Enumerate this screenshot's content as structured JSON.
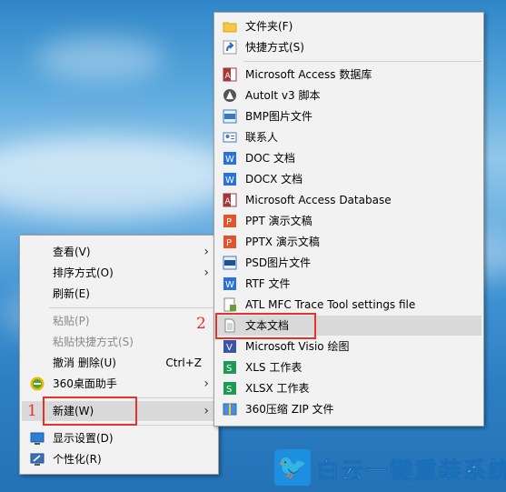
{
  "context_menu": {
    "items": [
      {
        "label": "查看(V)",
        "shortcut": "",
        "submenu": true,
        "disabled": false,
        "icon": ""
      },
      {
        "label": "排序方式(O)",
        "shortcut": "",
        "submenu": true,
        "disabled": false,
        "icon": ""
      },
      {
        "label": "刷新(E)",
        "shortcut": "",
        "submenu": false,
        "disabled": false,
        "icon": ""
      },
      {
        "label": "粘贴(P)",
        "shortcut": "",
        "submenu": false,
        "disabled": true,
        "icon": ""
      },
      {
        "label": "粘贴快捷方式(S)",
        "shortcut": "",
        "submenu": false,
        "disabled": true,
        "icon": ""
      },
      {
        "label": "撤消 删除(U)",
        "shortcut": "Ctrl+Z",
        "submenu": false,
        "disabled": false,
        "icon": ""
      },
      {
        "label": "360桌面助手",
        "shortcut": "",
        "submenu": true,
        "disabled": false,
        "icon": "360-assistant-icon"
      },
      {
        "label": "新建(W)",
        "shortcut": "",
        "submenu": true,
        "disabled": false,
        "icon": "",
        "highlighted": true
      },
      {
        "label": "显示设置(D)",
        "shortcut": "",
        "submenu": false,
        "disabled": false,
        "icon": "display-settings-icon"
      },
      {
        "label": "个性化(R)",
        "shortcut": "",
        "submenu": false,
        "disabled": false,
        "icon": "personalize-icon"
      }
    ]
  },
  "new_submenu": {
    "items": [
      {
        "label": "文件夹(F)",
        "icon": "folder-icon"
      },
      {
        "label": "快捷方式(S)",
        "icon": "shortcut-icon"
      },
      {
        "label": "Microsoft Access 数据库",
        "icon": "access-icon"
      },
      {
        "label": "AutoIt v3 脚本",
        "icon": "autoit-icon"
      },
      {
        "label": "BMP图片文件",
        "icon": "bmp-icon"
      },
      {
        "label": "联系人",
        "icon": "contact-icon"
      },
      {
        "label": "DOC 文档",
        "icon": "word-icon"
      },
      {
        "label": "DOCX 文档",
        "icon": "word-icon"
      },
      {
        "label": "Microsoft Access Database",
        "icon": "access-icon"
      },
      {
        "label": "PPT 演示文稿",
        "icon": "powerpoint-icon"
      },
      {
        "label": "PPTX 演示文稿",
        "icon": "powerpoint-icon"
      },
      {
        "label": "PSD图片文件",
        "icon": "psd-icon"
      },
      {
        "label": "RTF 文件",
        "icon": "word-icon"
      },
      {
        "label": "ATL MFC Trace Tool settings file",
        "icon": "trace-tool-icon"
      },
      {
        "label": "文本文档",
        "icon": "text-document-icon",
        "highlighted": true
      },
      {
        "label": "Microsoft Visio 绘图",
        "icon": "visio-icon"
      },
      {
        "label": "XLS 工作表",
        "icon": "excel-icon"
      },
      {
        "label": "XLSX 工作表",
        "icon": "excel-icon"
      },
      {
        "label": "360压缩 ZIP 文件",
        "icon": "zip-icon"
      }
    ]
  },
  "annotations": {
    "step1": "1",
    "step2": "2"
  },
  "watermark": {
    "brand": "白云一键重装系统"
  },
  "colors": {
    "menu_bg": "#f2f2f2",
    "highlight": "#d9d9d9",
    "annotation_red": "#e8312a",
    "watermark_blue": "#1d8ee0"
  }
}
